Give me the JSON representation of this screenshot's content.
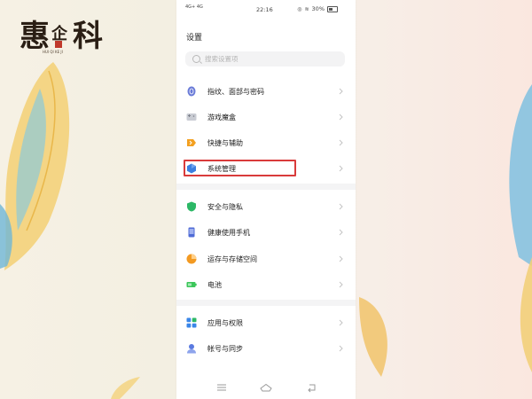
{
  "watermark": {
    "title": "惠企科",
    "subtitle": "HUI QI KE JI"
  },
  "statusbar": {
    "carrier": "4G+ 4G",
    "time": "22:16",
    "battery": "30%"
  },
  "header": {
    "title": "设置"
  },
  "search": {
    "placeholder": "搜索设置项"
  },
  "groups": [
    {
      "items": [
        {
          "label": "指纹、面部与密码",
          "icon": "fingerprint-shield-icon",
          "color": "#6a7bd8"
        },
        {
          "label": "游戏魔盒",
          "icon": "game-box-icon",
          "color": "#9a9ea8"
        },
        {
          "label": "快捷与辅助",
          "icon": "shortcut-icon",
          "color": "#f3a020"
        },
        {
          "label": "系统管理",
          "icon": "system-hexagon-icon",
          "color": "#3c7fe0"
        }
      ]
    },
    {
      "items": [
        {
          "label": "安全与隐私",
          "icon": "security-shield-icon",
          "color": "#2cb866"
        },
        {
          "label": "健康使用手机",
          "icon": "phone-health-icon",
          "color": "#4f6bd6"
        },
        {
          "label": "运存与存储空间",
          "icon": "storage-pie-icon",
          "color": "#f39a22"
        },
        {
          "label": "电池",
          "icon": "battery-icon",
          "color": "#3cc65a"
        }
      ]
    },
    {
      "items": [
        {
          "label": "应用与权限",
          "icon": "apps-grid-icon",
          "color": "#3a86e8"
        },
        {
          "label": "帐号与同步",
          "icon": "account-icon",
          "color": "#5a7ae0"
        }
      ]
    }
  ],
  "colors": {
    "highlight": "#d93b3b",
    "accent": "#3c7fe0"
  }
}
